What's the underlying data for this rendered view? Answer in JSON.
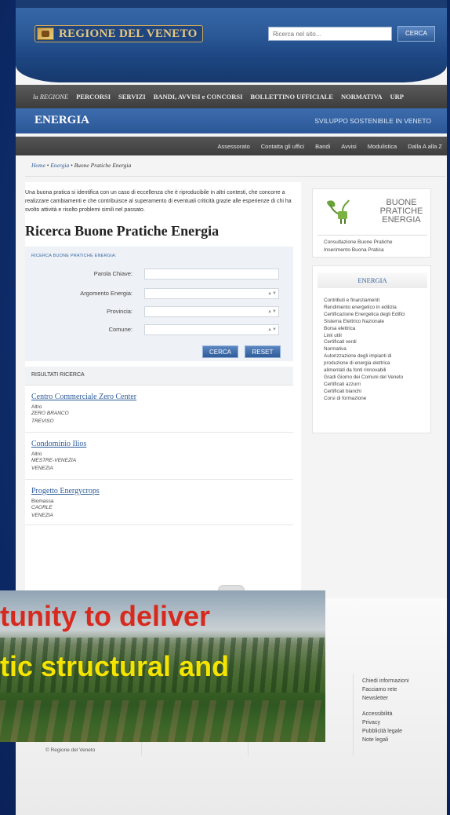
{
  "header": {
    "logo_text": "REGIONE DEL VENETO",
    "search_placeholder": "Ricerca nel sito...",
    "search_button": "CERCA"
  },
  "topnav": {
    "items": [
      "la REGIONE",
      "PERCORSI",
      "SERVIZI",
      "BANDI, AVVISI e CONCORSI",
      "BOLLETTINO UFFICIALE",
      "NORMATIVA",
      "URP"
    ]
  },
  "section": {
    "title": "ENERGIA",
    "subtitle": "SVILUPPO SOSTENIBILE IN VENETO"
  },
  "subnav": {
    "items": [
      "Assessorato",
      "Contatta gli uffici",
      "Bandi",
      "Avvisi",
      "Modulistica",
      "Dalla A alla Z"
    ]
  },
  "breadcrumb": {
    "home": "Home",
    "energia": "Energia",
    "current": "Buone Pratiche Energia"
  },
  "main": {
    "intro": "Una buona pratica si identifica con un caso di eccellenza che è riproducibile in altri contesti, che concorre a realizzare cambiamenti e che contribuisce al superamento di eventuali criticità grazie alle esperienze di chi ha svolto attività e risolto problemi simili nel passato.",
    "page_title": "Ricerca Buone Pratiche Energia",
    "form_title": "RICERCA BUONE PRATICHE ENERGIA:",
    "labels": {
      "keyword": "Parola Chiave:",
      "topic": "Argomento Energia:",
      "province": "Provincia:",
      "municipality": "Comune:"
    },
    "btn_search": "CERCA",
    "btn_reset": "RESET",
    "results_header": "RISULTATI RICERCA",
    "results": [
      {
        "title": "Centro Commerciale Zero Center",
        "category": "Altro",
        "city": "ZERO BRANCO",
        "province": "TREVISO"
      },
      {
        "title": "Condominio Ilios",
        "category": "Altro",
        "city": "MESTRE-VENEZIA",
        "province": "VENEZIA"
      },
      {
        "title": "Progetto Energycrops",
        "category": "Biomassa",
        "city": "CAORLE",
        "province": "VENEZIA"
      }
    ]
  },
  "sidebar": {
    "bpe_line1": "BUONE",
    "bpe_line2": "PRATICHE",
    "bpe_line3": "ENERGIA",
    "link1": "Consultazione Buone Pratiche",
    "link2": "Inserimento Buona Pratica",
    "energia_title": "ENERGIA",
    "energia_items": [
      "Contributi e finanziamenti",
      "Rendimento energetico in edilizia",
      "Certificazione Energetica degli Edifici",
      "Sistema Elettrico Nazionale",
      "Borsa elettrica",
      "Link utili",
      "Certificati verdi",
      "Normativa",
      "Autorizzazione degli impianti di",
      "produzione di energia elettrica",
      "alimentati da fonti rinnovabili",
      "Gradi Giorno dei Comuni del Veneto",
      "Certificati azzurri",
      "Certificati bianchi",
      "Corsi di formazione"
    ]
  },
  "footer": {
    "links1": [
      "Chiedi informazioni",
      "Facciamo rete",
      "Newsletter"
    ],
    "links2": [
      "Accessibilità",
      "Privacy",
      "Pubblicità legale",
      "Note legali"
    ],
    "copyright": "© Regione del Veneto"
  },
  "overlay": {
    "line1": "tunity to deliver",
    "line2": "tic structural and"
  },
  "colors": {
    "brand_blue": "#2c5a99",
    "link_blue": "#2d5b9a",
    "overlay_red": "#d62a1e",
    "overlay_yellow": "#f5e400"
  }
}
